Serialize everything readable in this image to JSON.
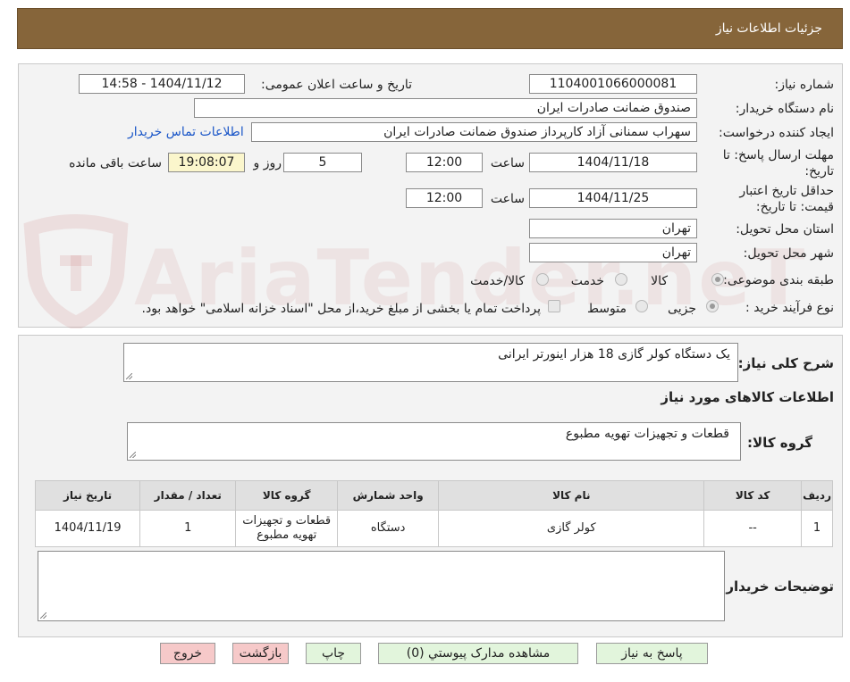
{
  "header": {
    "title": "جزئیات اطلاعات نیاز"
  },
  "watermark": {
    "text": "AriaTender.neT"
  },
  "form": {
    "need_number_label": "شماره نیاز:",
    "need_number": "1104001066000081",
    "announce_label": "تاریخ و ساعت اعلان عمومی:",
    "announce_value": "1404/11/12 - 14:58",
    "buyer_org_label": "نام دستگاه خریدار:",
    "buyer_org": "صندوق ضمانت صادرات ایران",
    "creator_label": "ایجاد کننده درخواست:",
    "creator": "سهراب سمنانی آزاد کارپرداز صندوق ضمانت صادرات ایران",
    "contact_link": "اطلاعات تماس خریدار",
    "deadline_label_1": "مهلت ارسال پاسخ: تا",
    "deadline_label_2": "تاریخ:",
    "deadline_date": "1404/11/18",
    "time_label": "ساعت",
    "deadline_time": "12:00",
    "days_value": "5",
    "days_label": "روز و",
    "remaining_time": "19:08:07",
    "remaining_label": "ساعت باقی مانده",
    "validity_label_1": "حداقل تاریخ اعتبار",
    "validity_label_2": "قیمت: تا تاریخ:",
    "validity_date": "1404/11/25",
    "validity_time": "12:00",
    "province_label": "استان محل تحویل:",
    "province": "تهران",
    "city_label": "شهر محل تحویل:",
    "city": "تهران",
    "category_label": "طبقه بندی موضوعی:",
    "category_options": [
      "کالا",
      "خدمت",
      "کالا/خدمت"
    ],
    "process_label": "نوع فرآیند خرید :",
    "process_options": [
      "جزیی",
      "متوسط"
    ],
    "treasury_note": "پرداخت تمام یا بخشی از مبلغ خرید،از محل \"اسناد خزانه اسلامی\" خواهد بود."
  },
  "details": {
    "summary_label": "شرح کلی نیاز:",
    "summary": "یک دستگاه کولر گازی 18 هزار اینورتر ایرانی",
    "goods_info_title": "اطلاعات کالاهای مورد نیاز",
    "goods_group_label": "گروه کالا:",
    "goods_group": "قطعات و تجهیزات تهویه مطبوع",
    "table": {
      "headers": [
        "ردیف",
        "کد کالا",
        "نام کالا",
        "واحد شمارش",
        "گروه کالا",
        "تعداد / مقدار",
        "تاریخ نیاز"
      ],
      "rows": [
        [
          "1",
          "--",
          "کولر گازی",
          "دستگاه",
          "قطعات و تجهیزات تهویه مطبوع",
          "1",
          "1404/11/19"
        ]
      ]
    },
    "buyer_notes_label": "توضیحات خریدار:"
  },
  "buttons": {
    "reply": "پاسخ به نیاز",
    "attachments": "مشاهده مدارک پیوستي (0)",
    "print": "چاپ",
    "back": "بازگشت",
    "exit": "خروج"
  },
  "colors": {
    "header_bg": "#86653a",
    "panel_bg": "#f3f3f3",
    "link": "#1a56c8",
    "highlight_field": "#fbf6cc",
    "green_button": "#e2f5dc",
    "pink_button": "#f6c9c9"
  }
}
